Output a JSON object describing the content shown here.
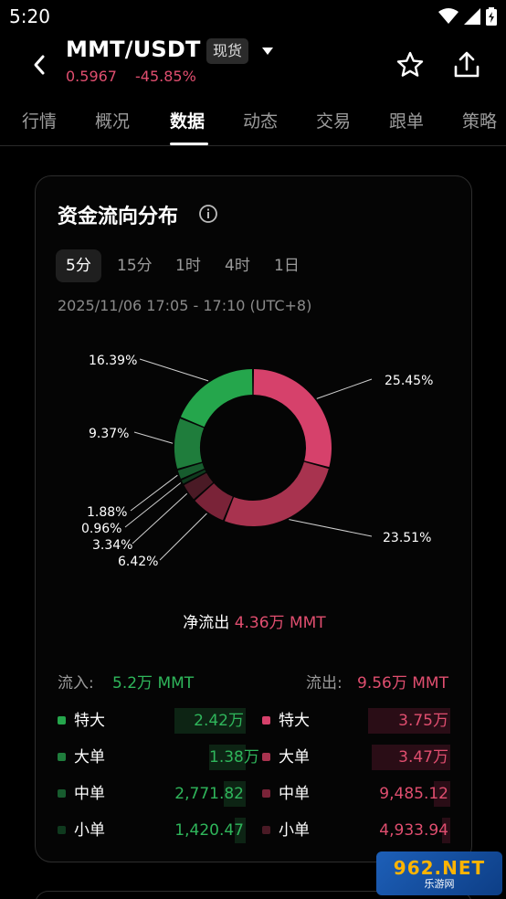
{
  "status_bar": {
    "time": "5:20",
    "icons": [
      "wifi-icon",
      "signal-icon",
      "battery-icon"
    ]
  },
  "header": {
    "pair": "MMT/USDT",
    "market_badge": "现货",
    "price": "0.5967",
    "change": "-45.85%"
  },
  "tabs": [
    "行情",
    "概况",
    "数据",
    "动态",
    "交易",
    "跟单",
    "策略"
  ],
  "active_tab": "数据",
  "card": {
    "title": "资金流向分布",
    "periods": [
      "5分",
      "15分",
      "1时",
      "4时",
      "1日"
    ],
    "active_period": "5分",
    "time_range": "2025/11/06 17:05 - 17:10 (UTC+8)"
  },
  "chart_data": {
    "type": "pie",
    "style": "donut",
    "slices": [
      {
        "label": "流出 特大",
        "value": 25.45,
        "text": "25.45%",
        "color": "#d6416b"
      },
      {
        "label": "流出 大单",
        "value": 23.51,
        "text": "23.51%",
        "color": "#a8334f"
      },
      {
        "label": "流出 中单",
        "value": 6.42,
        "text": "6.42%",
        "color": "#7a2338"
      },
      {
        "label": "流出 小单",
        "value": 3.34,
        "text": "3.34%",
        "color": "#4a1a25"
      },
      {
        "label": "流入 小单",
        "value": 0.96,
        "text": "0.96%",
        "color": "#0f3a1e"
      },
      {
        "label": "流入 中单",
        "value": 1.88,
        "text": "1.88%",
        "color": "#175c2e"
      },
      {
        "label": "流入 大单",
        "value": 9.37,
        "text": "9.37%",
        "color": "#1f7d3c"
      },
      {
        "label": "流入 特大",
        "value": 16.39,
        "text": "16.39%",
        "color": "#25a64c"
      }
    ]
  },
  "summary": {
    "net_label": "净流出",
    "net_value": "4.36万 MMT",
    "inflow_label": "流入:",
    "inflow_value": "5.2万 MMT",
    "outflow_label": "流出:",
    "outflow_value": "9.56万 MMT"
  },
  "inflow_rows": [
    {
      "label": "特大",
      "value": "2.42万",
      "color": "#25a64c"
    },
    {
      "label": "大单",
      "value": "1.38万",
      "color": "#1f7d3c"
    },
    {
      "label": "中单",
      "value": "2,771.82",
      "color": "#175c2e"
    },
    {
      "label": "小单",
      "value": "1,420.47",
      "color": "#0f3a1e"
    }
  ],
  "outflow_rows": [
    {
      "label": "特大",
      "value": "3.75万",
      "color": "#d6416b"
    },
    {
      "label": "大单",
      "value": "3.47万",
      "color": "#a8334f"
    },
    {
      "label": "中单",
      "value": "9,485.12",
      "color": "#7a2338"
    },
    {
      "label": "小单",
      "value": "4,933.94",
      "color": "#4a1a25"
    }
  ],
  "watermark": {
    "top": "962.NET",
    "bottom": "乐游网"
  }
}
